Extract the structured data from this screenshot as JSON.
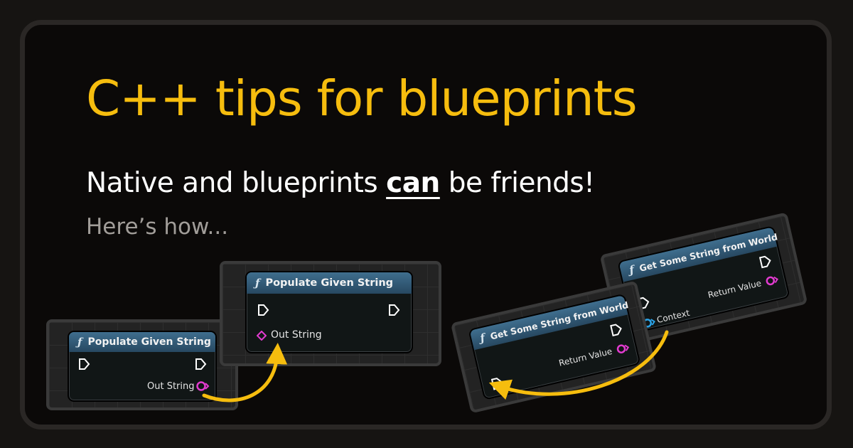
{
  "headline": {
    "title": "C++ tips for blueprints",
    "subtitle_before": "Native and blueprints",
    "subtitle_emphasis": "can",
    "subtitle_after": "be friends!",
    "lead": "Here’s how..."
  },
  "left_example": {
    "node_before": {
      "title": "Populate Given String",
      "pin": "Out String"
    },
    "node_after": {
      "title": "Populate Given String",
      "pin": "Out String"
    }
  },
  "right_example": {
    "node_before": {
      "title": "Get Some String from World",
      "pin_in": "Context",
      "pin_out": "Return Value"
    },
    "node_after": {
      "title": "Get Some String from World",
      "pin_out": "Return Value"
    }
  },
  "colors": {
    "accent": "#f6bd0e",
    "pin_string": "#e23bd0",
    "pin_object": "#2ba3e8",
    "node_header": "#3f6e8e"
  },
  "icons": {
    "function": "function-icon",
    "exec": "exec-pin-icon",
    "string_pin": "string-pin-icon",
    "object_pin": "object-pin-icon",
    "arrow": "curved-arrow-icon"
  }
}
